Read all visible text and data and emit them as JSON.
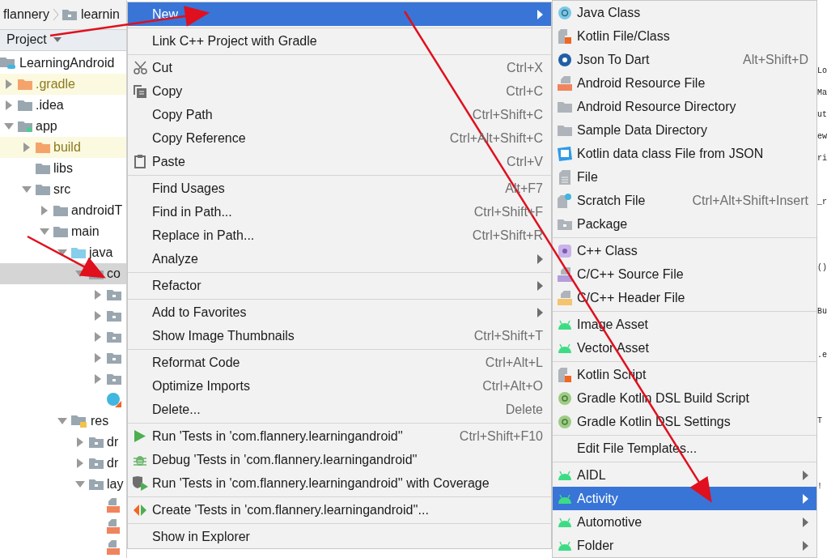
{
  "breadcrumb": [
    "flannery",
    "learnin"
  ],
  "project_panel": {
    "title": "Project",
    "tree": [
      {
        "label": "LearningAndroid",
        "kind": "module",
        "selected": false,
        "children": [
          {
            "label": ".gradle",
            "kind": "excluded",
            "expanded": false,
            "selected": false
          },
          {
            "label": ".idea",
            "kind": "folder",
            "expanded": false,
            "selected": false
          },
          {
            "label": "app",
            "kind": "module-folder",
            "expanded": true,
            "selected": false,
            "children": [
              {
                "label": "build",
                "kind": "excluded",
                "expanded": false,
                "selected": false
              },
              {
                "label": "libs",
                "kind": "folder",
                "selected": false
              },
              {
                "label": "src",
                "kind": "folder",
                "expanded": true,
                "selected": false,
                "children": [
                  {
                    "label": "androidT",
                    "kind": "folder",
                    "expanded": false,
                    "selected": false
                  },
                  {
                    "label": "main",
                    "kind": "folder",
                    "expanded": true,
                    "selected": false,
                    "children": [
                      {
                        "label": "java",
                        "kind": "source",
                        "expanded": true,
                        "selected": false,
                        "children": [
                          {
                            "label": "co",
                            "kind": "package",
                            "expanded": true,
                            "selected": true,
                            "children": [
                              {
                                "kind": "package",
                                "expanded": false,
                                "selected": false
                              },
                              {
                                "kind": "package",
                                "expanded": false,
                                "selected": false
                              },
                              {
                                "kind": "package",
                                "expanded": false,
                                "selected": false
                              },
                              {
                                "kind": "package",
                                "expanded": false,
                                "selected": false
                              },
                              {
                                "kind": "package",
                                "expanded": false,
                                "selected": false
                              },
                              {
                                "kind": "class",
                                "selected": false
                              }
                            ]
                          }
                        ]
                      },
                      {
                        "label": "res",
                        "kind": "res",
                        "expanded": true,
                        "selected": false,
                        "children": [
                          {
                            "label": "dr",
                            "kind": "package",
                            "expanded": false,
                            "selected": false
                          },
                          {
                            "label": "dr",
                            "kind": "package",
                            "expanded": false,
                            "selected": false
                          },
                          {
                            "label": "lay",
                            "kind": "package",
                            "expanded": true,
                            "selected": false,
                            "children": [
                              {
                                "kind": "layout",
                                "selected": false
                              },
                              {
                                "kind": "layout",
                                "selected": false
                              },
                              {
                                "kind": "layout",
                                "selected": false
                              }
                            ]
                          }
                        ]
                      }
                    ]
                  }
                ]
              }
            ]
          }
        ]
      }
    ]
  },
  "context_menu": [
    {
      "kind": "item",
      "label": "New",
      "submenu": true,
      "selected": true
    },
    {
      "kind": "separator"
    },
    {
      "kind": "item",
      "label": "Link C++ Project with Gradle",
      "selected": false
    },
    {
      "kind": "separator"
    },
    {
      "kind": "item",
      "label": "Cut",
      "shortcut": "Ctrl+X",
      "selected": false
    },
    {
      "kind": "item",
      "label": "Copy",
      "shortcut": "Ctrl+C",
      "selected": false
    },
    {
      "kind": "item",
      "label": "Copy Path",
      "shortcut": "Ctrl+Shift+C",
      "selected": false
    },
    {
      "kind": "item",
      "label": "Copy Reference",
      "shortcut": "Ctrl+Alt+Shift+C",
      "selected": false
    },
    {
      "kind": "item",
      "label": "Paste",
      "shortcut": "Ctrl+V",
      "selected": false
    },
    {
      "kind": "separator"
    },
    {
      "kind": "item",
      "label": "Find Usages",
      "shortcut": "Alt+F7",
      "selected": false
    },
    {
      "kind": "item",
      "label": "Find in Path...",
      "shortcut": "Ctrl+Shift+F",
      "selected": false
    },
    {
      "kind": "item",
      "label": "Replace in Path...",
      "shortcut": "Ctrl+Shift+R",
      "selected": false
    },
    {
      "kind": "item",
      "label": "Analyze",
      "submenu": true,
      "selected": false
    },
    {
      "kind": "separator"
    },
    {
      "kind": "item",
      "label": "Refactor",
      "submenu": true,
      "selected": false
    },
    {
      "kind": "separator"
    },
    {
      "kind": "item",
      "label": "Add to Favorites",
      "submenu": true,
      "selected": false
    },
    {
      "kind": "item",
      "label": "Show Image Thumbnails",
      "shortcut": "Ctrl+Shift+T",
      "selected": false
    },
    {
      "kind": "separator"
    },
    {
      "kind": "item",
      "label": "Reformat Code",
      "shortcut": "Ctrl+Alt+L",
      "selected": false
    },
    {
      "kind": "item",
      "label": "Optimize Imports",
      "shortcut": "Ctrl+Alt+O",
      "selected": false
    },
    {
      "kind": "item",
      "label": "Delete...",
      "shortcut": "Delete",
      "selected": false
    },
    {
      "kind": "separator"
    },
    {
      "kind": "item",
      "label": "Run 'Tests in 'com.flannery.learningandroid''",
      "shortcut": "Ctrl+Shift+F10",
      "selected": false
    },
    {
      "kind": "item",
      "label": "Debug 'Tests in 'com.flannery.learningandroid''",
      "selected": false
    },
    {
      "kind": "item",
      "label": "Run 'Tests in 'com.flannery.learningandroid'' with Coverage",
      "selected": false
    },
    {
      "kind": "separator"
    },
    {
      "kind": "item",
      "label": "Create 'Tests in 'com.flannery.learningandroid''...",
      "selected": false
    },
    {
      "kind": "separator"
    },
    {
      "kind": "item",
      "label": "Show in Explorer",
      "selected": false
    }
  ],
  "new_submenu": [
    {
      "kind": "item",
      "label": "Java Class",
      "selected": false
    },
    {
      "kind": "item",
      "label": "Kotlin File/Class",
      "selected": false
    },
    {
      "kind": "item",
      "label": "Json To Dart",
      "shortcut": "Alt+Shift+D",
      "selected": false
    },
    {
      "kind": "item",
      "label": "Android Resource File",
      "selected": false
    },
    {
      "kind": "item",
      "label": "Android Resource Directory",
      "selected": false
    },
    {
      "kind": "item",
      "label": "Sample Data Directory",
      "selected": false
    },
    {
      "kind": "item",
      "label": "Kotlin data class File from JSON",
      "selected": false
    },
    {
      "kind": "item",
      "label": "File",
      "selected": false
    },
    {
      "kind": "item",
      "label": "Scratch File",
      "shortcut": "Ctrl+Alt+Shift+Insert",
      "selected": false
    },
    {
      "kind": "item",
      "label": "Package",
      "selected": false
    },
    {
      "kind": "separator"
    },
    {
      "kind": "item",
      "label": "C++ Class",
      "selected": false
    },
    {
      "kind": "item",
      "label": "C/C++ Source File",
      "selected": false
    },
    {
      "kind": "item",
      "label": "C/C++ Header File",
      "selected": false
    },
    {
      "kind": "separator"
    },
    {
      "kind": "item",
      "label": "Image Asset",
      "selected": false
    },
    {
      "kind": "item",
      "label": "Vector Asset",
      "selected": false
    },
    {
      "kind": "separator"
    },
    {
      "kind": "item",
      "label": "Kotlin Script",
      "selected": false
    },
    {
      "kind": "item",
      "label": "Gradle Kotlin DSL Build Script",
      "selected": false
    },
    {
      "kind": "item",
      "label": "Gradle Kotlin DSL Settings",
      "selected": false
    },
    {
      "kind": "separator"
    },
    {
      "kind": "item",
      "label": "Edit File Templates...",
      "selected": false
    },
    {
      "kind": "separator"
    },
    {
      "kind": "item",
      "label": "AIDL",
      "submenu": true,
      "selected": false
    },
    {
      "kind": "item",
      "label": "Activity",
      "submenu": true,
      "selected": true
    },
    {
      "kind": "item",
      "label": "Automotive",
      "submenu": true,
      "selected": false
    },
    {
      "kind": "item",
      "label": "Folder",
      "submenu": true,
      "selected": false
    }
  ],
  "editor_lines": [
    {
      "kind": "code",
      "text": "Lo"
    },
    {
      "kind": "code",
      "text": "Ma"
    },
    {
      "kind": "code",
      "text": "ut"
    },
    {
      "kind": "code",
      "text": "ew"
    },
    {
      "kind": "code",
      "text": "ri"
    },
    {
      "kind": "blank"
    },
    {
      "kind": "code",
      "text": "_r"
    },
    {
      "kind": "blank"
    },
    {
      "kind": "blank"
    },
    {
      "kind": "code",
      "text": "()"
    },
    {
      "kind": "blank"
    },
    {
      "kind": "code",
      "text": "Bu"
    },
    {
      "kind": "blank"
    },
    {
      "kind": "code",
      "text": ".e"
    },
    {
      "kind": "blank"
    },
    {
      "kind": "blank"
    },
    {
      "kind": "code",
      "text": "T"
    },
    {
      "kind": "blank"
    },
    {
      "kind": "blank"
    },
    {
      "kind": "code",
      "text": "!"
    }
  ],
  "annotations": [
    {
      "kind": "arrow"
    },
    {
      "kind": "arrow"
    },
    {
      "kind": "arrow"
    }
  ]
}
